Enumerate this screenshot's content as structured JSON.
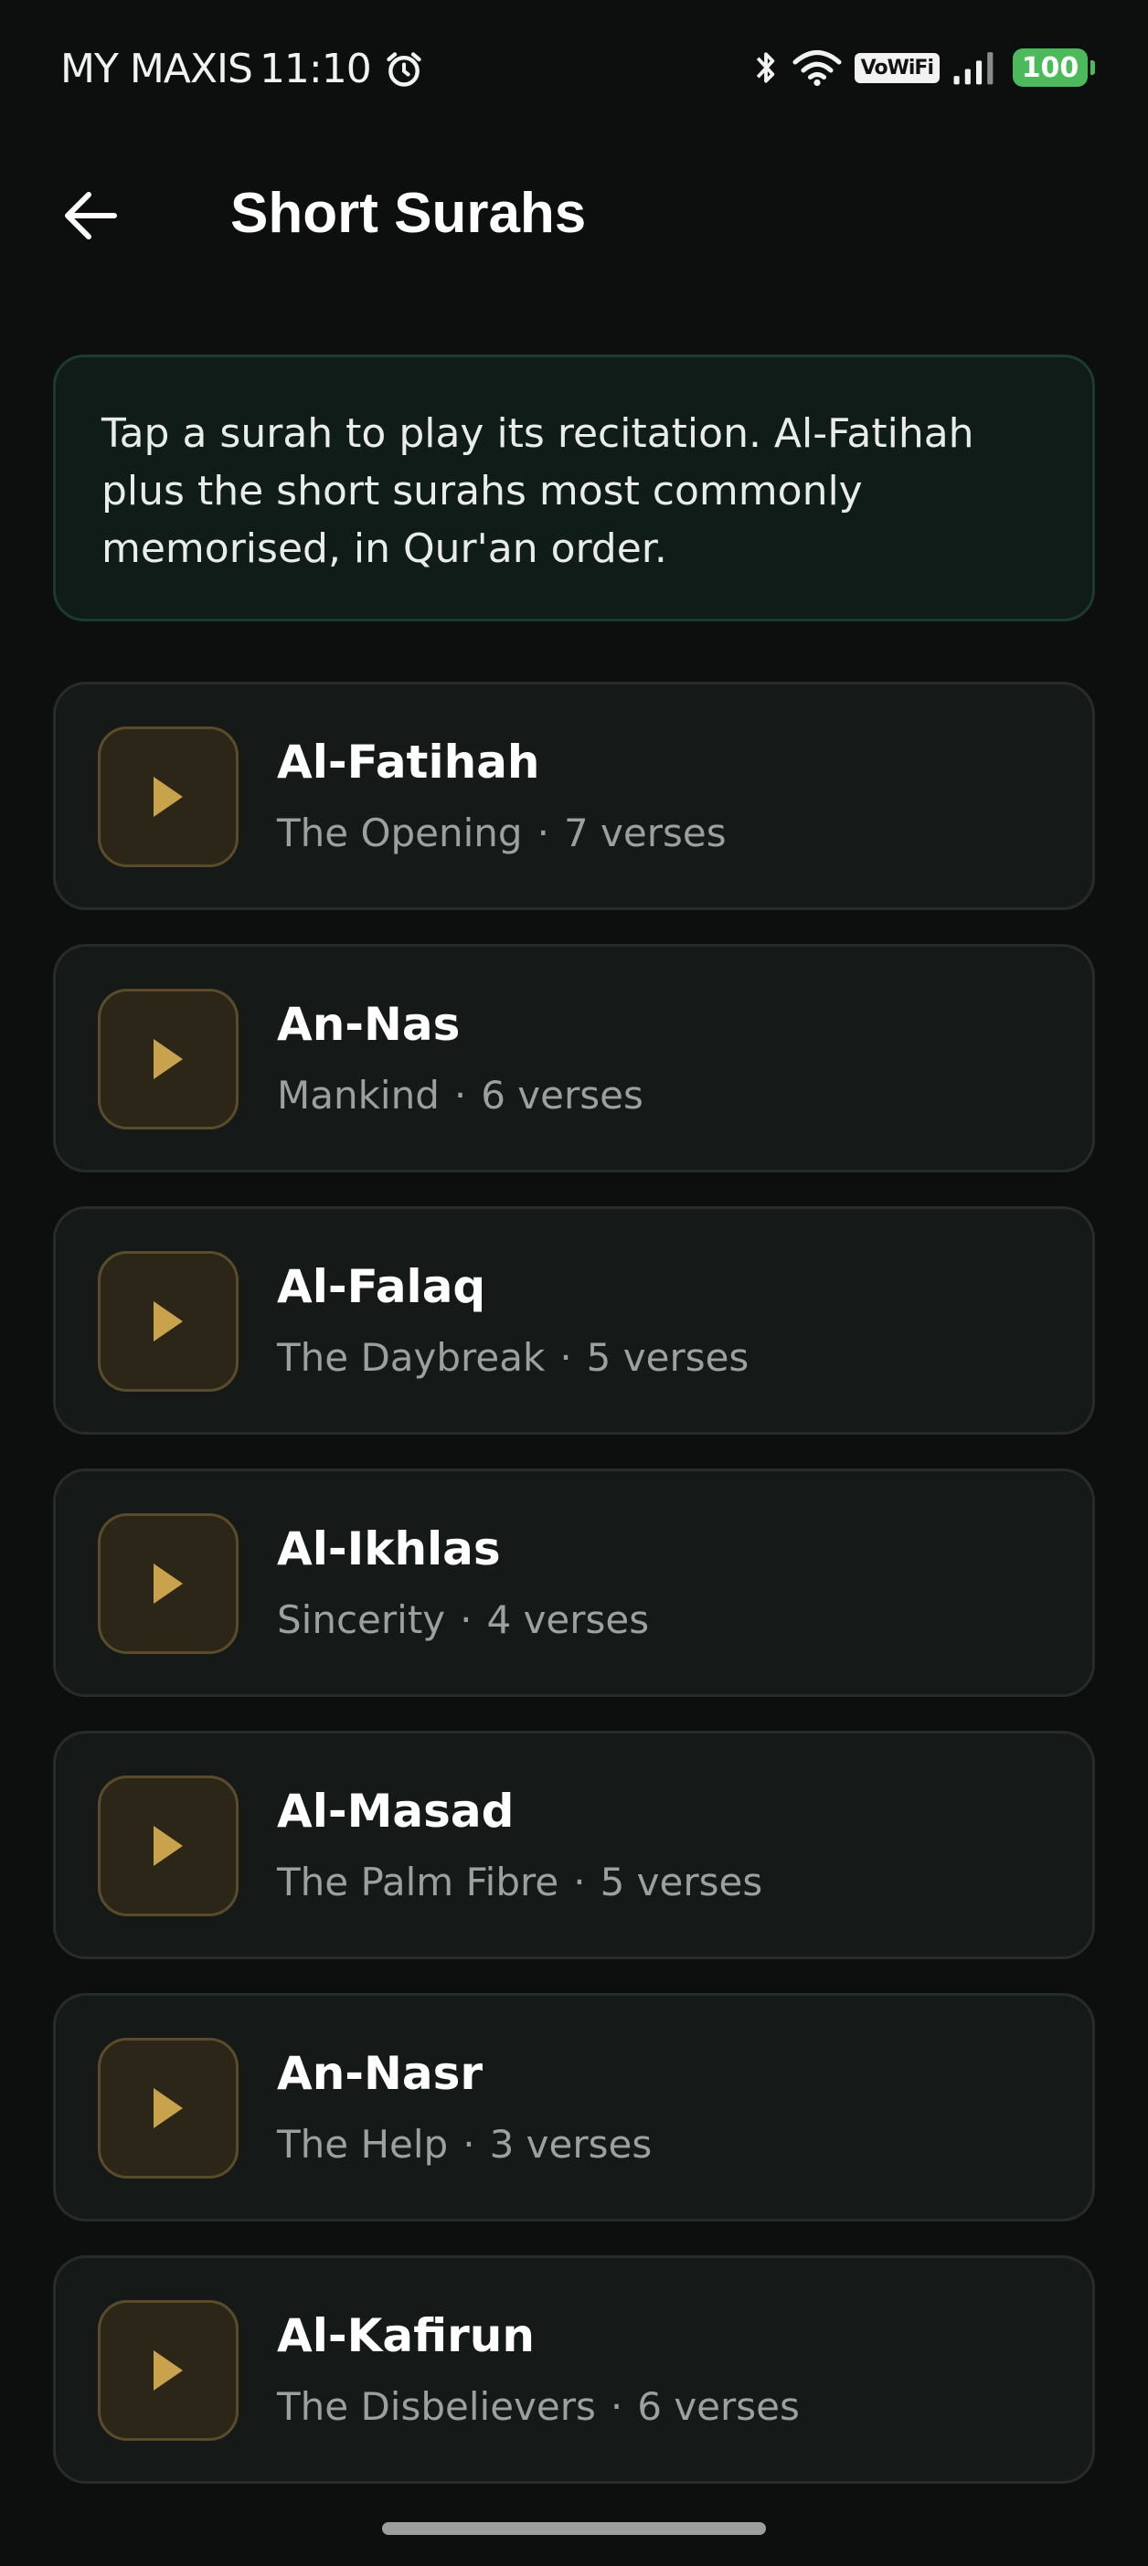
{
  "status_bar": {
    "carrier": "MY MAXIS",
    "time": "11:10",
    "vowifi_label": "VoWiFi",
    "battery_level": "100",
    "icons": [
      "alarm-icon",
      "bluetooth-icon",
      "wifi-icon",
      "vowifi-icon",
      "signal-icon",
      "battery-icon"
    ]
  },
  "app_bar": {
    "back_icon": "arrow-left-icon",
    "title": "Short Surahs"
  },
  "info": {
    "text": "Tap a surah to play its recitation. Al-Fatihah plus the short surahs most commonly memorised, in Qur'an order."
  },
  "surahs": [
    {
      "name": "Al-Fatihah",
      "translation": "The Opening",
      "verses": "7 verses"
    },
    {
      "name": "An-Nas",
      "translation": "Mankind",
      "verses": "6 verses"
    },
    {
      "name": "Al-Falaq",
      "translation": "The Daybreak",
      "verses": "5 verses"
    },
    {
      "name": "Al-Ikhlas",
      "translation": "Sincerity",
      "verses": "4 verses"
    },
    {
      "name": "Al-Masad",
      "translation": "The Palm Fibre",
      "verses": "5 verses"
    },
    {
      "name": "An-Nasr",
      "translation": "The Help",
      "verses": "3 verses"
    },
    {
      "name": "Al-Kafirun",
      "translation": "The Disbelievers",
      "verses": "6 verses"
    }
  ],
  "meta_separator": "·",
  "colors": {
    "background": "#0c0f0e",
    "card": "#151a19",
    "info_box": "#0f1c17",
    "accent_gold": "#c9a24e",
    "battery_green": "#4cba5a"
  }
}
